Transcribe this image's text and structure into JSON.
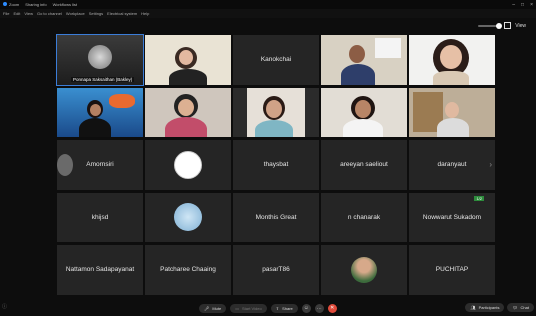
{
  "topbar": {
    "app": "Zoom",
    "item2": "Sharing info",
    "item3": "Workflows list"
  },
  "menubar": [
    "File",
    "Edit",
    "View",
    "Go to channel",
    "Workplace",
    "Settings",
    "Electrical system",
    "Help"
  ],
  "view_label": "View",
  "tiles": [
    {
      "name": "",
      "corner": "Ponnapa Saksaithan (Bakley)",
      "kind": "video-room",
      "active": true
    },
    {
      "name": "",
      "corner": "",
      "kind": "video-girl"
    },
    {
      "name": "Kanokchai",
      "corner": "",
      "kind": "name"
    },
    {
      "name": "",
      "corner": "",
      "kind": "video-man"
    },
    {
      "name": "",
      "corner": "",
      "kind": "video-woman2"
    },
    {
      "name": "",
      "corner": "",
      "kind": "video-aquarium"
    },
    {
      "name": "",
      "corner": "",
      "kind": "video-lady"
    },
    {
      "name": "",
      "corner": "",
      "kind": "video-mask"
    },
    {
      "name": "",
      "corner": "",
      "kind": "video-smile"
    },
    {
      "name": "",
      "corner": "",
      "kind": "video-office"
    },
    {
      "name": "Amornsiri",
      "corner": "",
      "kind": "name-avatar"
    },
    {
      "name": "",
      "corner": "",
      "kind": "logo"
    },
    {
      "name": "thaysbat",
      "corner": "",
      "kind": "name"
    },
    {
      "name": "areeyan saeliout",
      "corner": "",
      "kind": "name"
    },
    {
      "name": "daranyaut",
      "corner": "",
      "kind": "name"
    },
    {
      "name": "khijsd",
      "corner": "",
      "kind": "name"
    },
    {
      "name": "",
      "corner": "",
      "kind": "blue-circle"
    },
    {
      "name": "Monthis Great",
      "corner": "",
      "kind": "name"
    },
    {
      "name": "n chanarak",
      "corner": "",
      "kind": "name"
    },
    {
      "name": "Nowwarut Sukadom",
      "corner": "",
      "kind": "name"
    },
    {
      "name": "Nattamon Sadapayanat",
      "corner": "",
      "kind": "name"
    },
    {
      "name": "Patcharee Chaaing",
      "corner": "",
      "kind": "name"
    },
    {
      "name": "pasarT86",
      "corner": "",
      "kind": "name"
    },
    {
      "name": "",
      "corner": "",
      "kind": "photo-avatar"
    },
    {
      "name": "PUCHITAP",
      "corner": "",
      "kind": "name"
    }
  ],
  "page_indicator": "1/2",
  "toolbar": {
    "mute": "Mute",
    "video": "Start Video",
    "share": "Share",
    "participants": "Participants",
    "chat": "Chat"
  },
  "colors": {
    "accent": "#2d8cff",
    "end": "#e04a3a",
    "tile": "#252525"
  }
}
